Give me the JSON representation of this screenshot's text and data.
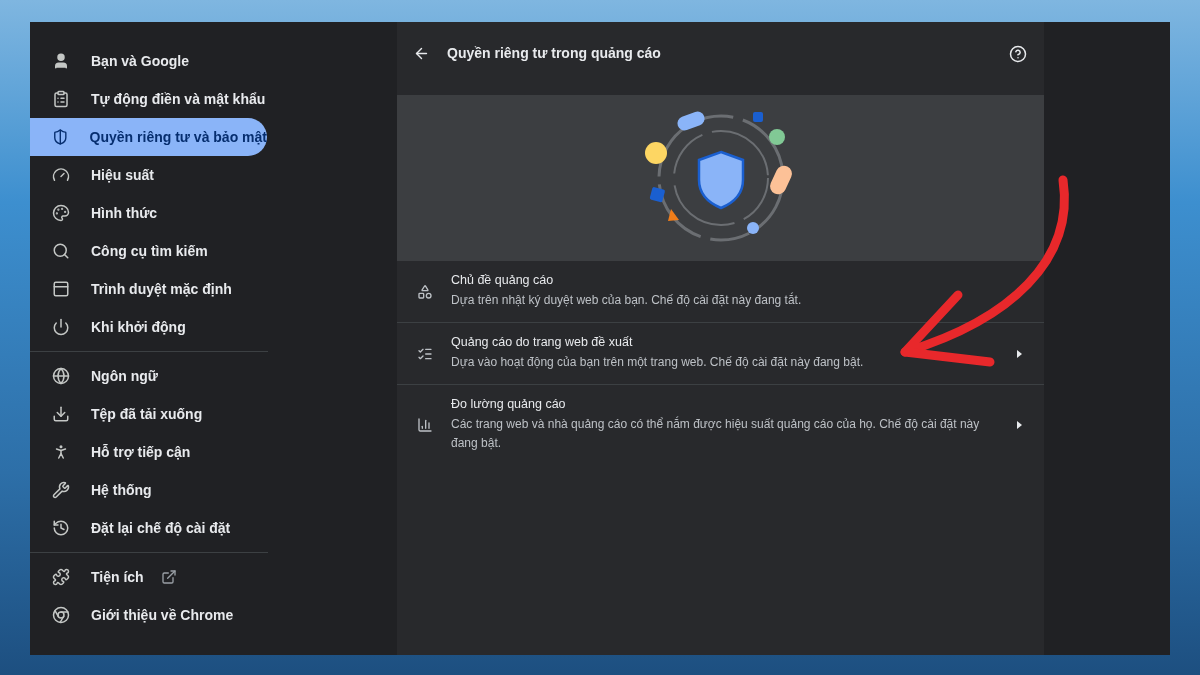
{
  "sidebar": {
    "groups": [
      {
        "items": [
          {
            "label": "Bạn và Google",
            "selected": false,
            "external": false
          },
          {
            "label": "Tự động điền và mật khẩu",
            "selected": false,
            "external": false
          },
          {
            "label": "Quyền riêng tư và bảo mật",
            "selected": true,
            "external": false
          },
          {
            "label": "Hiệu suất",
            "selected": false,
            "external": false
          },
          {
            "label": "Hình thức",
            "selected": false,
            "external": false
          },
          {
            "label": "Công cụ tìm kiếm",
            "selected": false,
            "external": false
          },
          {
            "label": "Trình duyệt mặc định",
            "selected": false,
            "external": false
          },
          {
            "label": "Khi khởi động",
            "selected": false,
            "external": false
          }
        ]
      },
      {
        "items": [
          {
            "label": "Ngôn ngữ",
            "selected": false,
            "external": false
          },
          {
            "label": "Tệp đã tải xuống",
            "selected": false,
            "external": false
          },
          {
            "label": "Hỗ trợ tiếp cận",
            "selected": false,
            "external": false
          },
          {
            "label": "Hệ thống",
            "selected": false,
            "external": false
          },
          {
            "label": "Đặt lại chế độ cài đặt",
            "selected": false,
            "external": false
          }
        ]
      },
      {
        "items": [
          {
            "label": "Tiện ích",
            "selected": false,
            "external": true
          },
          {
            "label": "Giới thiệu về Chrome",
            "selected": false,
            "external": false
          }
        ]
      }
    ]
  },
  "page": {
    "title": "Quyền riêng tư trong quảng cáo",
    "rows": [
      {
        "title": "Chủ đề quảng cáo",
        "description": "Dựa trên nhật ký duyệt web của bạn. Chế độ cài đặt này đang tắt."
      },
      {
        "title": "Quảng cáo do trang web đề xuất",
        "description": "Dựa vào hoạt động của bạn trên một trang web. Chế độ cài đặt này đang bật."
      },
      {
        "title": "Đo lường quảng cáo",
        "description": "Các trang web và nhà quảng cáo có thể nắm được hiệu suất quảng cáo của họ. Chế độ cài đặt này đang bật."
      }
    ]
  }
}
